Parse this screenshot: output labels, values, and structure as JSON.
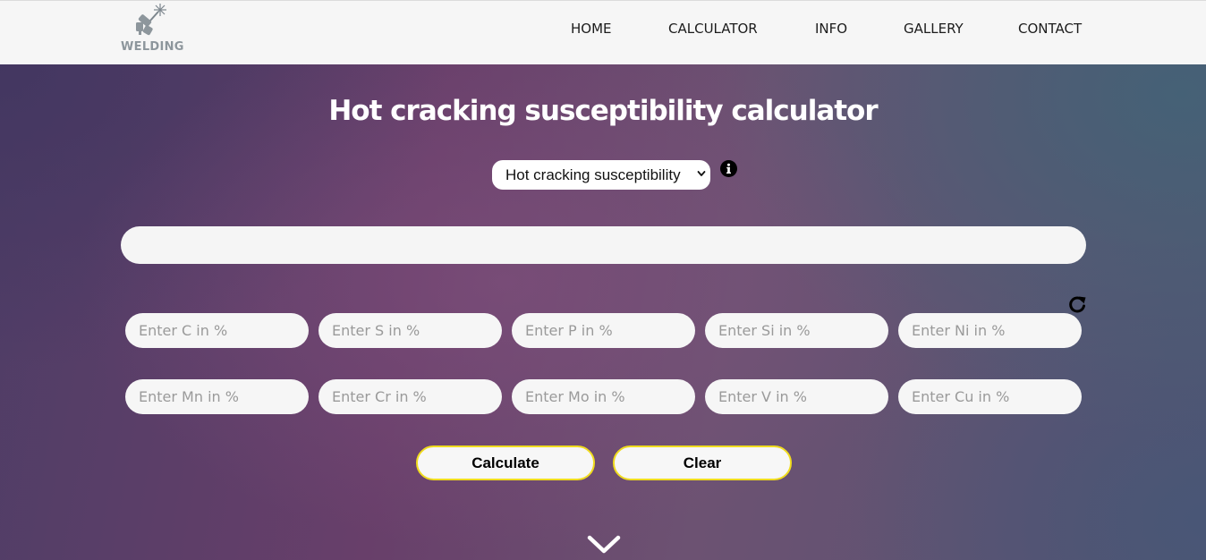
{
  "logo": {
    "text": "WELDING",
    "icon": "welding-torch-icon"
  },
  "nav": {
    "items": [
      {
        "label": "HOME"
      },
      {
        "label": "CALCULATOR"
      },
      {
        "label": "INFO"
      },
      {
        "label": "GALLERY"
      },
      {
        "label": "CONTACT"
      }
    ]
  },
  "main": {
    "title": "Hot cracking susceptibility calculator",
    "mode_select": {
      "selected": "Hot cracking susceptibility",
      "icon": "chevron-down-icon"
    },
    "info_icon": "info-icon",
    "result_value": "",
    "reset_icon": "refresh-icon",
    "fields": [
      {
        "placeholder": "Enter C in %",
        "value": ""
      },
      {
        "placeholder": "Enter S in %",
        "value": ""
      },
      {
        "placeholder": "Enter P in %",
        "value": ""
      },
      {
        "placeholder": "Enter Si in %",
        "value": ""
      },
      {
        "placeholder": "Enter Ni in %",
        "value": ""
      },
      {
        "placeholder": "Enter Mn in %",
        "value": ""
      },
      {
        "placeholder": "Enter Cr in %",
        "value": ""
      },
      {
        "placeholder": "Enter Mo in %",
        "value": ""
      },
      {
        "placeholder": "Enter V in %",
        "value": ""
      },
      {
        "placeholder": "Enter Cu in %",
        "value": ""
      }
    ],
    "buttons": {
      "calculate": "Calculate",
      "clear": "Clear"
    },
    "scroll_icon": "chevron-down-icon"
  },
  "colors": {
    "header_bg": "#f6f6f6",
    "logo_gray": "#8d969c",
    "button_border": "#f0dc1e",
    "title_text": "#ffffff"
  }
}
